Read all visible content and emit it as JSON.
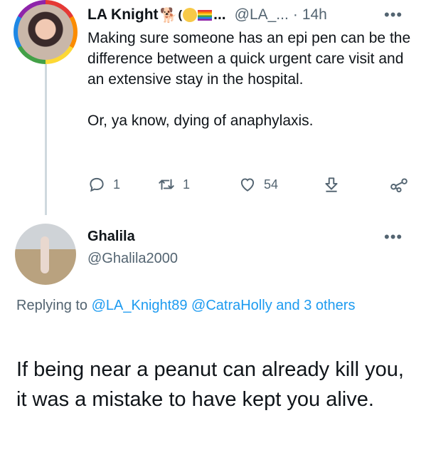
{
  "tweet1": {
    "author_name": "LA Knight",
    "emoji_paren": "(",
    "name_ellipsis": "...",
    "handle": "@LA_...",
    "separator": "·",
    "time": "14h",
    "more": "•••",
    "text_p1": "Making sure someone has an epi pen can be the difference between a quick urgent care visit and an extensive stay in the hospital.",
    "text_p2": "Or, ya know, dying of anaphylaxis.",
    "reply_count": "1",
    "retweet_count": "1",
    "like_count": "54",
    "icons": [
      "reply-icon",
      "retweet-icon",
      "like-icon",
      "download-icon",
      "share-icon"
    ]
  },
  "tweet2": {
    "author_name": "Ghalila",
    "handle": "@Ghalila2000",
    "more": "•••",
    "replying_prefix": "Replying to",
    "mention1": "@LA_Knight89",
    "mention2": "@CatraHolly",
    "and_others": "and 3 others",
    "text": "If being near a peanut can already kill you, it was a mistake to have kept you alive."
  },
  "colors": {
    "link": "#1d9bf0",
    "secondary_text": "#536471",
    "thread_line": "#cfd9de"
  }
}
